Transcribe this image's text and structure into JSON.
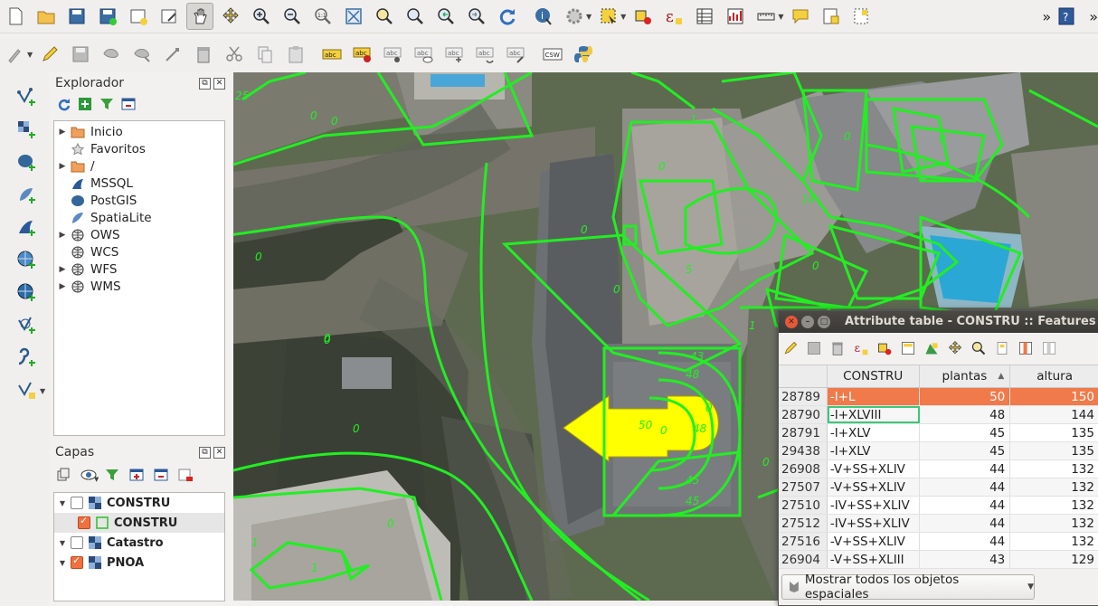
{
  "explorer": {
    "title": "Explorador",
    "items": [
      {
        "label": "Inicio",
        "icon": "folder-icon",
        "expandable": true
      },
      {
        "label": "Favoritos",
        "icon": "star-icon",
        "expandable": false
      },
      {
        "label": "/",
        "icon": "folder-icon",
        "expandable": true
      },
      {
        "label": "MSSQL",
        "icon": "mssql-icon",
        "expandable": false
      },
      {
        "label": "PostGIS",
        "icon": "postgis-icon",
        "expandable": false
      },
      {
        "label": "SpatiaLite",
        "icon": "spatialite-icon",
        "expandable": false
      },
      {
        "label": "OWS",
        "icon": "globe-icon",
        "expandable": true
      },
      {
        "label": "WCS",
        "icon": "globe-icon",
        "expandable": false
      },
      {
        "label": "WFS",
        "icon": "globe-icon",
        "expandable": true
      },
      {
        "label": "WMS",
        "icon": "globe-icon",
        "expandable": true
      }
    ]
  },
  "layers": {
    "title": "Capas",
    "items": [
      {
        "label": "CONSTRU",
        "checked": false,
        "expandable": true,
        "selected": false
      },
      {
        "label": "CONSTRU",
        "checked": true,
        "expandable": false,
        "selected": true
      },
      {
        "label": "Catastro",
        "checked": false,
        "expandable": true,
        "selected": false
      },
      {
        "label": "PNOA",
        "checked": true,
        "expandable": true,
        "selected": false
      }
    ]
  },
  "map": {
    "labels": [
      "25",
      "0",
      "0",
      "0",
      "0",
      "1",
      "0",
      "18",
      "5",
      "0",
      "0",
      "2",
      "0",
      "1",
      "0",
      "0",
      "0",
      "0",
      "43",
      "48",
      "50",
      "0",
      "48",
      "0",
      "45",
      "45",
      "0",
      "0",
      "1",
      "1"
    ]
  },
  "attribute_table": {
    "title": "Attribute table - CONSTRU :: Features t",
    "columns": [
      "CONSTRU",
      "plantas",
      "altura"
    ],
    "sort_indicator": "▲",
    "rows": [
      {
        "id": "28789",
        "constru": "-I+L",
        "plantas": "50",
        "altura": "150"
      },
      {
        "id": "28790",
        "constru": "-I+XLVIII",
        "plantas": "48",
        "altura": "144"
      },
      {
        "id": "28791",
        "constru": "-I+XLV",
        "plantas": "45",
        "altura": "135"
      },
      {
        "id": "29438",
        "constru": "-I+XLV",
        "plantas": "45",
        "altura": "135"
      },
      {
        "id": "26908",
        "constru": "-V+SS+XLIV",
        "plantas": "44",
        "altura": "132"
      },
      {
        "id": "27507",
        "constru": "-V+SS+XLIV",
        "plantas": "44",
        "altura": "132"
      },
      {
        "id": "27510",
        "constru": "-IV+SS+XLIV",
        "plantas": "44",
        "altura": "132"
      },
      {
        "id": "27512",
        "constru": "-IV+SS+XLIV",
        "plantas": "44",
        "altura": "132"
      },
      {
        "id": "27516",
        "constru": "-V+SS+XLIV",
        "plantas": "44",
        "altura": "132"
      },
      {
        "id": "26904",
        "constru": "-V+SS+XLIII",
        "plantas": "43",
        "altura": "129"
      }
    ],
    "footer_label": "Mostrar todos los objetos espaciales",
    "highlight_color": "#f07a4a"
  },
  "toolbar": {
    "overflow": "»",
    "help": "?",
    "csw": "CSW",
    "abc": "abc",
    "epsilon": "ε"
  }
}
